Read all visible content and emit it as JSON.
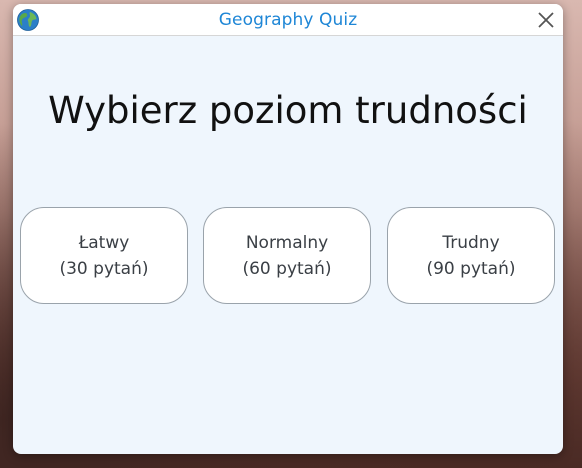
{
  "window": {
    "title": "Geography Quiz",
    "app_icon": "globe-icon",
    "close_icon": "close-icon"
  },
  "main": {
    "heading": "Wybierz poziom trudności",
    "levels": [
      {
        "name": "Łatwy",
        "questions": "(30 pytań)"
      },
      {
        "name": "Normalny",
        "questions": "(60 pytań)"
      },
      {
        "name": "Trudny",
        "questions": "(90 pytań)"
      }
    ]
  },
  "colors": {
    "title": "#1e86d6",
    "window_background": "#eff6fd",
    "button_border": "#9aa3ab"
  }
}
